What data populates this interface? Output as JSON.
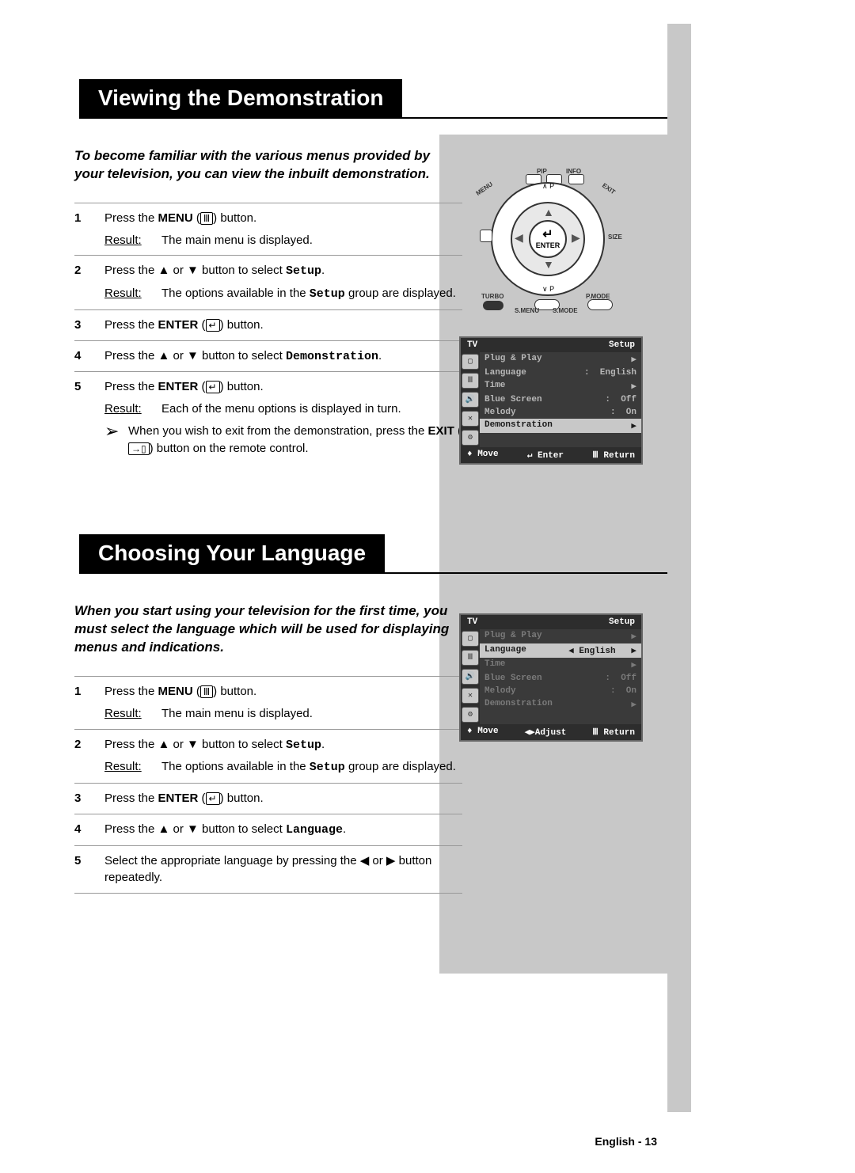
{
  "section1": {
    "title": "Viewing the Demonstration",
    "intro": "To become familiar with the various menus provided by your television, you can view the inbuilt demonstration.",
    "steps": [
      {
        "num": "1",
        "text_a": "Press the ",
        "bold": "MENU",
        "icon": "Ⅲ",
        "text_b": " button.",
        "result": "The main menu is displayed."
      },
      {
        "num": "2",
        "text_a": "Press the ▲ or ▼ button to select ",
        "mono": "Setup",
        "text_b": ".",
        "result_a": "The options available in the ",
        "result_mono": "Setup",
        "result_b": " group are displayed."
      },
      {
        "num": "3",
        "text_a": "Press the ",
        "bold": "ENTER",
        "icon": "↵",
        "text_b": " button."
      },
      {
        "num": "4",
        "text_a": "Press the ▲ or ▼ button to select ",
        "mono": "Demonstration",
        "text_b": "."
      },
      {
        "num": "5",
        "text_a": "Press the ",
        "bold": "ENTER",
        "icon": "↵",
        "text_b": " button.",
        "result": "Each of the menu options is displayed in turn.",
        "note_a": "When you wish to exit from the demonstration, press the ",
        "note_bold": "EXIT",
        "note_icon": "→▯",
        "note_b": " button on the remote control."
      }
    ]
  },
  "section2": {
    "title": "Choosing Your Language",
    "intro": "When you start using your television for the first time, you must select the language which will be used for displaying menus and indications.",
    "steps": [
      {
        "num": "1",
        "text_a": "Press the ",
        "bold": "MENU",
        "icon": "Ⅲ",
        "text_b": " button.",
        "result": "The main menu is displayed."
      },
      {
        "num": "2",
        "text_a": "Press the ▲ or ▼ button to select ",
        "mono": "Setup",
        "text_b": ".",
        "result_a": "The options available in the ",
        "result_mono": "Setup",
        "result_b": " group are displayed."
      },
      {
        "num": "3",
        "text_a": "Press the ",
        "bold": "ENTER",
        "icon": "↵",
        "text_b": " button."
      },
      {
        "num": "4",
        "text_a": "Press the ▲ or ▼ button to select ",
        "mono": "Language",
        "text_b": "."
      },
      {
        "num": "5",
        "text_plain": "Select the appropriate language by pressing the ◀ or ▶ button repeatedly."
      }
    ]
  },
  "remote": {
    "pip": "PIP",
    "info": "INFO",
    "menu": "MENU",
    "exit": "EXIT",
    "size": "SIZE",
    "turbo": "TURBO",
    "pmode": "P.MODE",
    "smenu": "S.MENU",
    "smode": "S.MODE",
    "enter": "ENTER",
    "enter_glyph": "↵",
    "ch_up": "∧ P",
    "ch_dn": "∨ P"
  },
  "osd1": {
    "title_l": "TV",
    "title_r": "Setup",
    "rows": [
      {
        "label": "Plug & Play",
        "val": "▶"
      },
      {
        "label": "Language",
        "val": ":  English"
      },
      {
        "label": "Time",
        "val": "▶"
      },
      {
        "label": "Blue Screen",
        "val": ":  Off"
      },
      {
        "label": "Melody",
        "val": ":  On"
      },
      {
        "label": "Demonstration",
        "val": "▶",
        "sel": true
      }
    ],
    "footer": {
      "l": "♦ Move",
      "c": "↵ Enter",
      "r": "Ⅲ Return"
    }
  },
  "osd2": {
    "title_l": "TV",
    "title_r": "Setup",
    "rows": [
      {
        "label": "Plug & Play",
        "val": "▶",
        "dim": true
      },
      {
        "label": "Language",
        "val": "◀ English   ▶",
        "sel": true
      },
      {
        "label": "Time",
        "val": "▶",
        "dim": true
      },
      {
        "label": "Blue Screen",
        "val": ":  Off",
        "dim": true
      },
      {
        "label": "Melody",
        "val": ":  On",
        "dim": true
      },
      {
        "label": "Demonstration",
        "val": "▶",
        "dim": true
      }
    ],
    "footer": {
      "l": "♦ Move",
      "c": "◀▶Adjust",
      "r": "Ⅲ Return"
    }
  },
  "labels": {
    "result": "Result:"
  },
  "footer": "English - 13"
}
